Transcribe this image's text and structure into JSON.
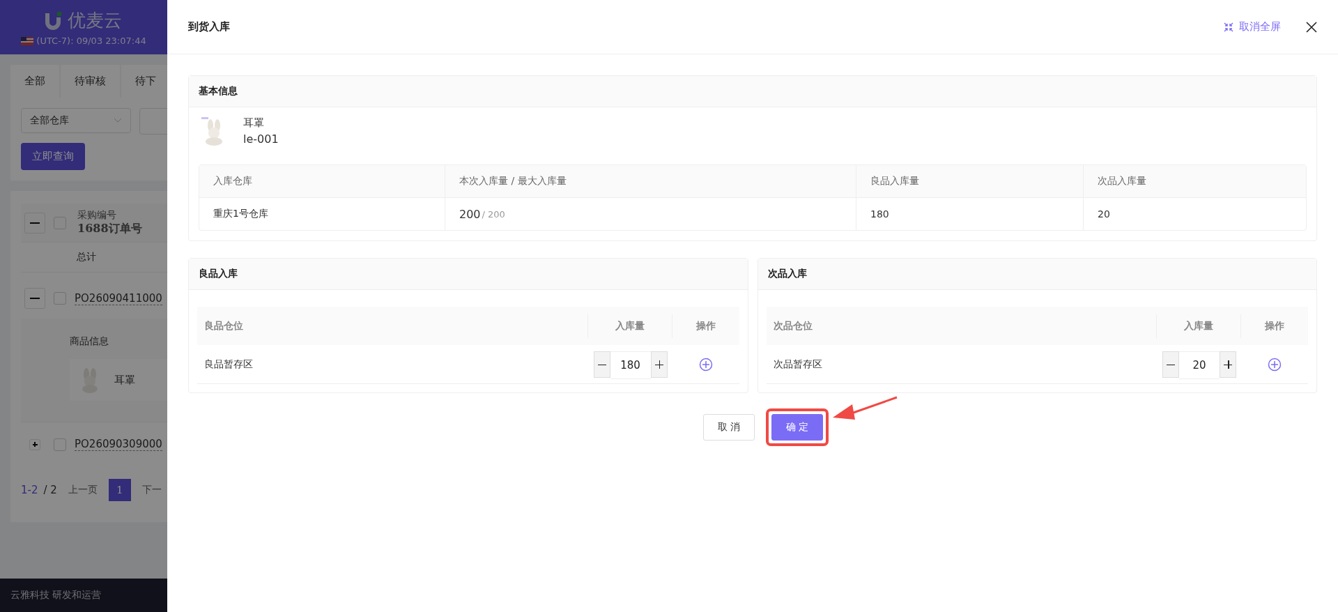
{
  "background_page": {
    "logo": "优麦云",
    "timezone": "(UTC-7): 09/03 23:07:44",
    "tabs": [
      {
        "label": "全部",
        "selected": false
      },
      {
        "label": "待审核",
        "selected": false
      },
      {
        "label": "待下",
        "selected": false
      }
    ],
    "warehouse_filter": {
      "value": "全部仓库"
    },
    "query_button": "立即查询",
    "table": {
      "header_expanded": true,
      "header_checked": false,
      "header_lines": [
        "采购编号",
        "1688订单号"
      ],
      "total_label": "总计",
      "orders": [
        {
          "number": "PO26090411000",
          "expanded": true,
          "checked": false,
          "section_label": "商品信息",
          "product": "耳罩"
        },
        {
          "number": "PO26090309000",
          "expanded": false,
          "checked": false
        }
      ]
    },
    "pagination": {
      "range": "1-2",
      "total": "/ 2",
      "prev": "上一页",
      "pages": [
        {
          "label": "1",
          "selected": true
        }
      ],
      "next": "下一"
    },
    "footer": "云雅科技 研发和运营"
  },
  "drawer": {
    "title": "到货入库",
    "exit_fullscreen": "取消全屏",
    "basic_info": {
      "title": "基本信息",
      "product_name": "耳罩",
      "sku": "le-001",
      "columns": [
        "入库仓库",
        "本次入库量 / 最大入库量",
        "良品入库量",
        "次品入库量"
      ],
      "row": {
        "warehouse": "重庆1号仓库",
        "quantity": "200",
        "max": "/ 200",
        "good": "180",
        "defective": "20"
      }
    },
    "sections": [
      {
        "title": "良品入库",
        "columns": [
          "良品仓位",
          "入库量",
          "操作"
        ],
        "rows": [
          {
            "location": "良品暂存区",
            "quantity": "180"
          }
        ]
      },
      {
        "title": "次品入库",
        "columns": [
          "次品仓位",
          "入库量",
          "操作"
        ],
        "rows": [
          {
            "location": "次品暂存区",
            "quantity": "20"
          }
        ]
      }
    ],
    "buttons": [
      {
        "label": "取 消",
        "kind": "default"
      },
      {
        "label": "确 定",
        "kind": "primary",
        "highlighted": true
      }
    ]
  }
}
